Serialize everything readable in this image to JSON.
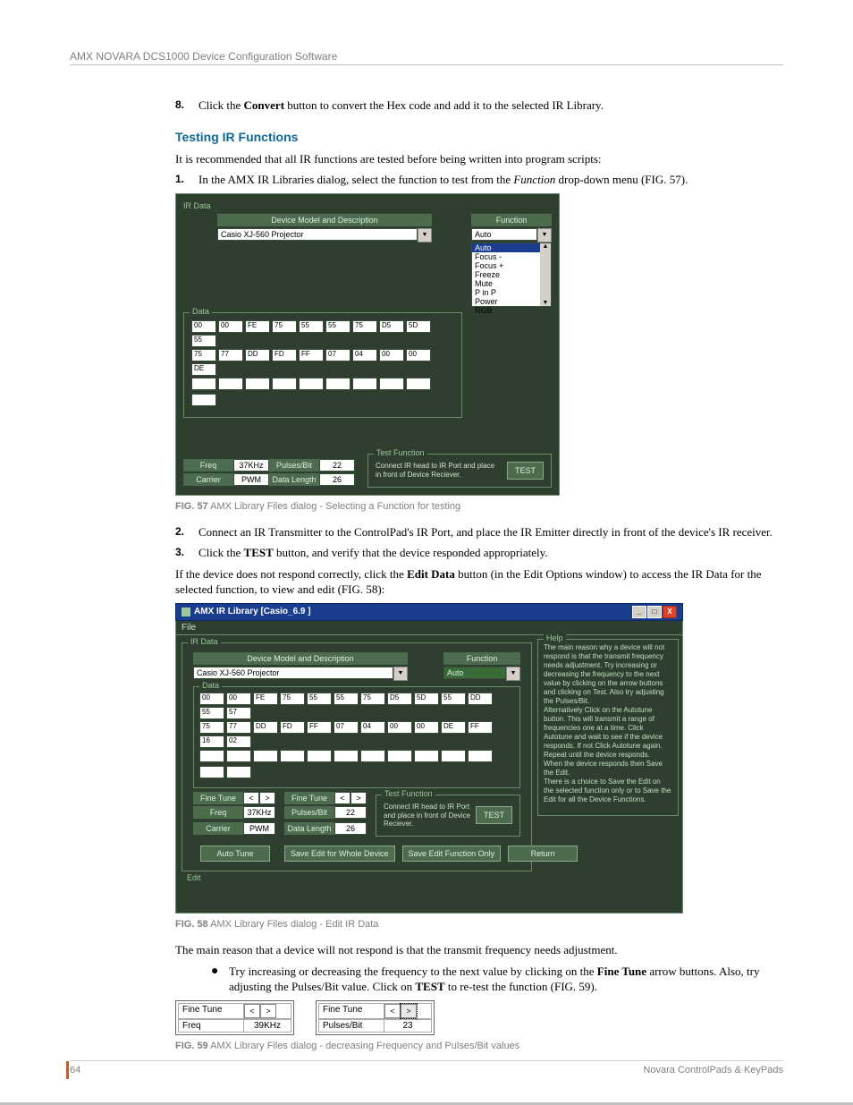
{
  "header": "AMX NOVARA DCS1000 Device Configuration Software",
  "step8": {
    "num": "8.",
    "text_a": "Click the ",
    "bold": "Convert",
    "text_b": " button to convert the Hex code and add it to the selected IR Library."
  },
  "section_heading": "Testing IR Functions",
  "intro": "It is recommended that all IR functions are tested before being written into program scripts:",
  "step1": {
    "num": "1.",
    "text_a": "In the AMX IR Libraries dialog, select the function to test from the ",
    "ital": "Function",
    "text_b": " drop-down menu (FIG. 57)."
  },
  "fig57": {
    "ir_data": "IR Data",
    "desc_label": "Device Model and Description",
    "desc_value": "Casio XJ-560   Projector",
    "func_label": "Function",
    "func_value": "Auto",
    "func_options": [
      "Auto",
      "Focus -",
      "Focus +",
      "Freeze",
      "Mute",
      "P in P",
      "Power",
      "RGB"
    ],
    "data_label": "Data",
    "row1": [
      "00",
      "00",
      "FE",
      "75",
      "55",
      "55",
      "75",
      "D5",
      "5D",
      "55"
    ],
    "row2": [
      "75",
      "77",
      "DD",
      "FD",
      "FF",
      "07",
      "04",
      "00",
      "00",
      "DE"
    ],
    "freq_label": "Freq",
    "freq_value": "37KHz",
    "carrier_label": "Carrier",
    "carrier_value": "PWM",
    "pulses_label": "Pulses/Bit",
    "pulses_value": "22",
    "datalen_label": "Data Length",
    "datalen_value": "26",
    "test_section": "Test Function",
    "test_msg": "Connect IR head to IR Port and place in front of Device Reciever.",
    "test_btn": "TEST"
  },
  "fig57_cap_b": "FIG. 57",
  "fig57_cap": "  AMX Library Files dialog - Selecting a Function for testing",
  "step2": {
    "num": "2.",
    "text": "Connect an IR Transmitter to the ControlPad's IR Port, and place the IR Emitter directly in front of the device's IR receiver."
  },
  "step3": {
    "num": "3.",
    "text_a": "Click the ",
    "bold": "TEST",
    "text_b": " button, and verify that the device responded appropriately."
  },
  "para_after": {
    "a": "If the device does not respond correctly, click the ",
    "bold": "Edit Data",
    "b": " button (in the Edit Options window) to access the IR Data for the selected function, to view and edit (FIG. 58):"
  },
  "fig58": {
    "title": "AMX  IR Library  [Casio_6.9 ]",
    "menu_file": "File",
    "ir_data": "IR Data",
    "desc_label": "Device Model and Description",
    "desc_value": "Casio XJ-560   Projector",
    "func_label": "Function",
    "func_value": "Auto",
    "data_label": "Data",
    "row1": [
      "00",
      "00",
      "FE",
      "75",
      "55",
      "55",
      "75",
      "D5",
      "5D",
      "55",
      "DD",
      "55",
      "57"
    ],
    "row2": [
      "75",
      "77",
      "DD",
      "FD",
      "FF",
      "07",
      "04",
      "00",
      "00",
      "DE",
      "FF",
      "16",
      "02"
    ],
    "finetune_label": "Fine Tune",
    "freq_label": "Freq",
    "freq_value": "37KHz",
    "carrier_label": "Carrier",
    "carrier_value": "PWM",
    "pulses_label": "Pulses/Bit",
    "pulses_value": "22",
    "datalen_label": "Data Length",
    "datalen_value": "26",
    "test_section": "Test Function",
    "test_msg": "Connect IR head to IR Port and place in front of Device Reciever.",
    "test_btn": "TEST",
    "autotune_btn": "Auto Tune",
    "save_whole_btn": "Save Edit for Whole Device",
    "save_func_btn": "Save Edit Function Only",
    "return_btn": "Return",
    "edit_label": "Edit",
    "help_label": "Help",
    "help_text": "The main reason why a device will not respond is that the transmit frequency needs adjustment. Try increasing or decreasing the frequency to the next value by clicking on the arrow buttons and clicking on Test. Also try adjusting the Pulses/Bit.\nAlternatively Click on the Autotune button. This will transmit a range of frequencies one at a time. Click Autotune and wait to see if the device responds.  If not Click Autotune again. Repeat until the device responds.\nWhen the device responds then Save the Edit.\nThere is a choice to Save the Edit on the selected function only or to Save the Edit for all the Device Functions."
  },
  "fig58_cap_b": "FIG. 58",
  "fig58_cap": "  AMX Library Files dialog - Edit IR Data",
  "para_main_reason": "The main reason that a device will not respond is that the transmit frequency needs adjustment.",
  "bullet": {
    "a": "Try increasing or decreasing the frequency to the next value by clicking on the ",
    "bold1": "Fine Tune",
    "b": " arrow buttons. Also, try adjusting the Pulses/Bit value. Click on ",
    "bold2": "TEST",
    "c": " to re-test the function (FIG. 59)."
  },
  "fig59": {
    "finetune_label": "Fine Tune",
    "freq_label": "Freq",
    "freq_value": "39KHz",
    "pulses_label": "Pulses/Bit",
    "pulses_value": "23"
  },
  "fig59_cap_b": "FIG. 59",
  "fig59_cap": "  AMX Library Files dialog - decreasing Frequency and Pulses/Bit values",
  "footer_page": "64",
  "footer_right": "Novara ControlPads & KeyPads"
}
